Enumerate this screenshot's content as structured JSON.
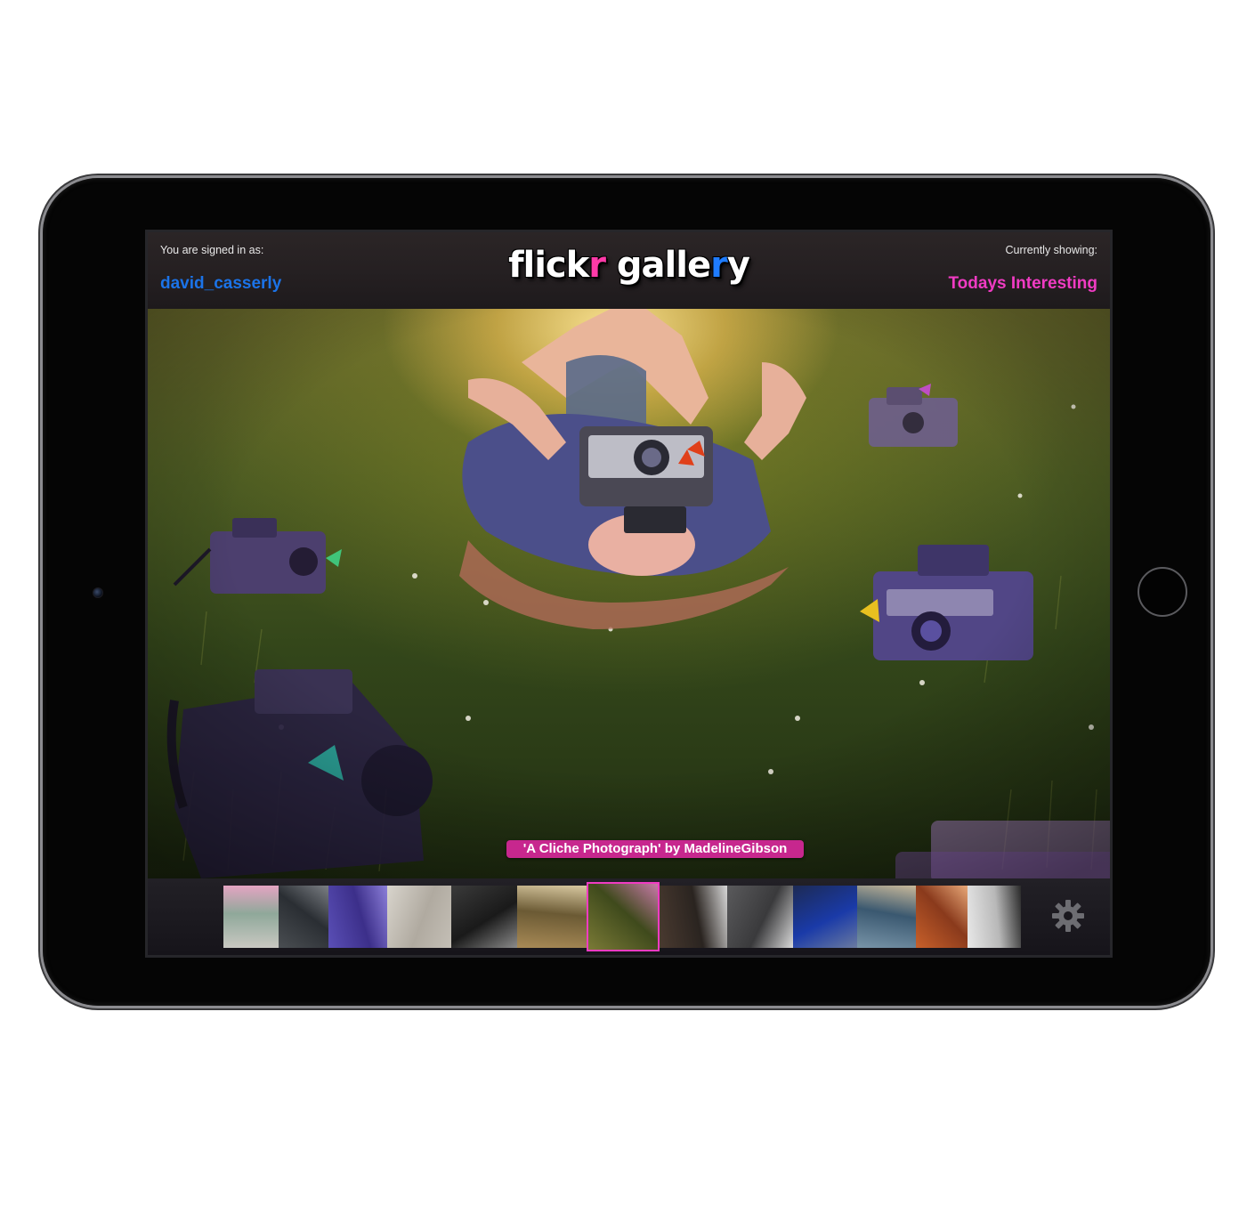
{
  "header": {
    "signed_in_label": "You are signed in as:",
    "username": "david_casserly",
    "showing_label": "Currently showing:",
    "category": "Todays Interesting",
    "logo": {
      "part1": "flick",
      "part2": "r",
      "part3": " galle",
      "part4": "r",
      "part5": "y"
    }
  },
  "photo": {
    "caption": "'A Cliche Photograph' by MadelineGibson"
  },
  "filmstrip": {
    "thumbnails": [
      {
        "width": 62,
        "colors": [
          "#c9c8c2",
          "#8fa89a",
          "#e4a4c2"
        ]
      },
      {
        "width": 56,
        "colors": [
          "#4a4e52",
          "#2a2e33",
          "#7b7f84"
        ]
      },
      {
        "width": 66,
        "colors": [
          "#5a4fb6",
          "#3c2f8a",
          "#8b7ed8"
        ]
      },
      {
        "width": 72,
        "colors": [
          "#d8d4cc",
          "#b0aaa0",
          "#c4bfb6"
        ]
      },
      {
        "width": 74,
        "colors": [
          "#3a3a3a",
          "#1a1a1a",
          "#8a8a8a"
        ]
      },
      {
        "width": 78,
        "colors": [
          "#a88a56",
          "#6b5a34",
          "#d8c8a0"
        ]
      },
      {
        "width": 82,
        "colors": [
          "#7a7a36",
          "#3f4a1c",
          "#c87aa8"
        ],
        "selected": true
      },
      {
        "width": 76,
        "colors": [
          "#4a3a30",
          "#2a2420",
          "#d8d8d8"
        ]
      },
      {
        "width": 74,
        "colors": [
          "#5a5a5c",
          "#3a3a3c",
          "#d9d9d9"
        ]
      },
      {
        "width": 72,
        "colors": [
          "#1c2a54",
          "#1a3aa8",
          "#6a7aa0"
        ]
      },
      {
        "width": 66,
        "colors": [
          "#7894a8",
          "#3a5870",
          "#c8b89a"
        ]
      },
      {
        "width": 58,
        "colors": [
          "#c8602a",
          "#8a3a1c",
          "#e8a878"
        ]
      },
      {
        "width": 60,
        "colors": [
          "#e8e8e8",
          "#b8b8b8",
          "#2a2a2a"
        ]
      }
    ],
    "settings_icon": "gear-icon"
  }
}
